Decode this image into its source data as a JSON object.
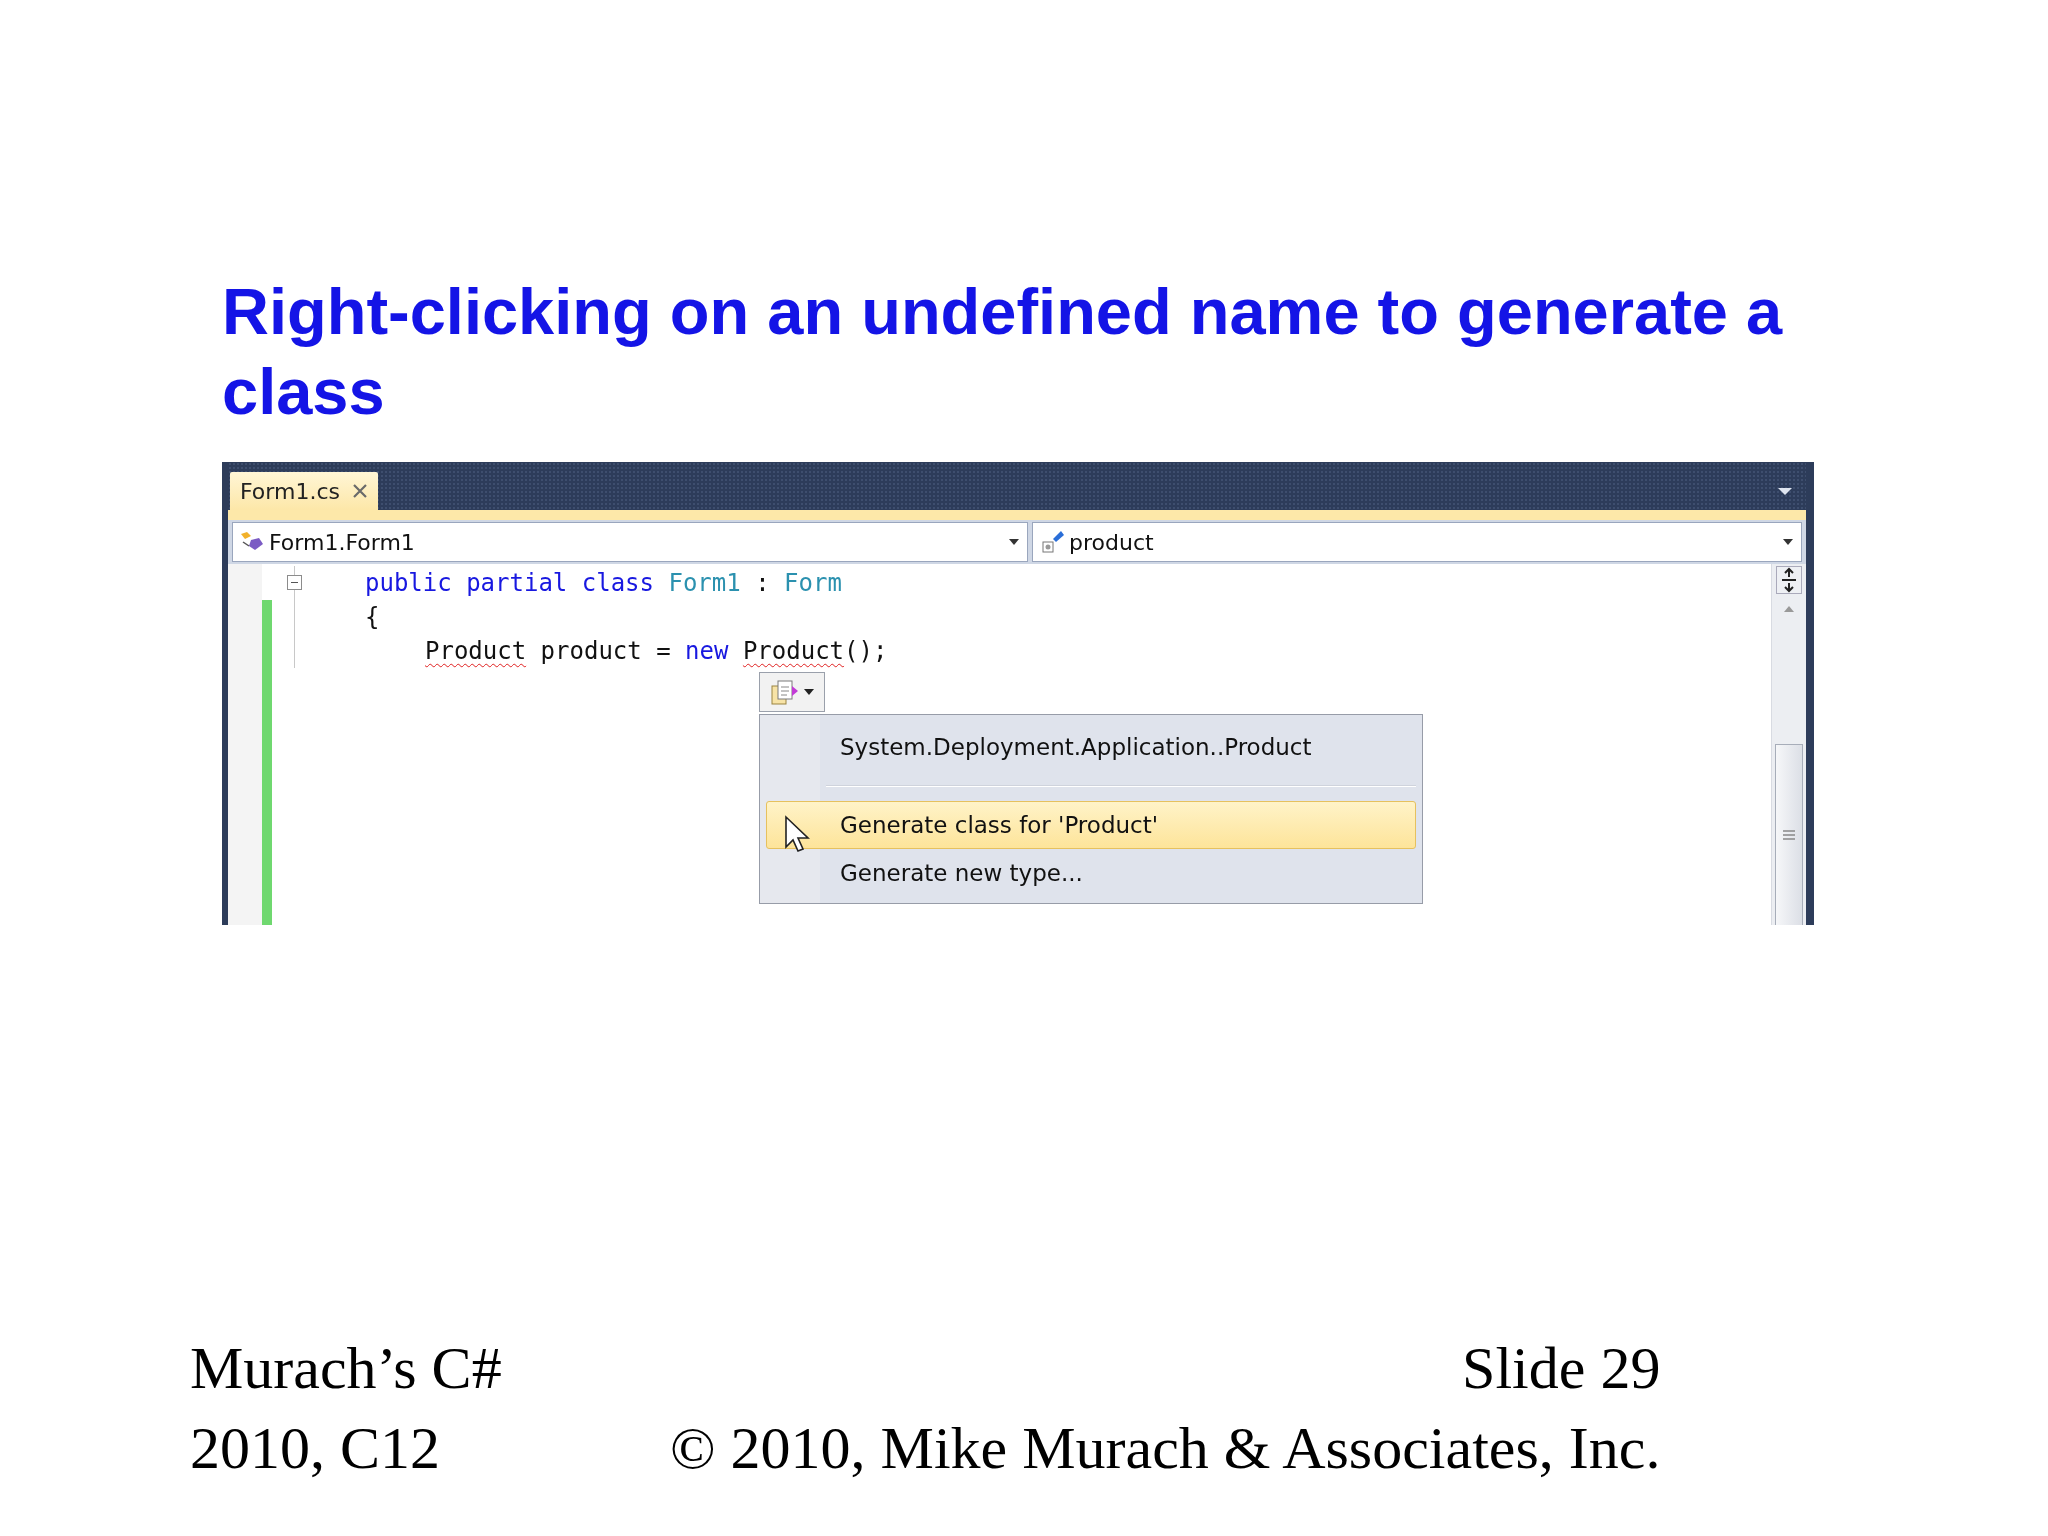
{
  "slide": {
    "title": "Right-clicking on an undefined name to generate a class"
  },
  "editor": {
    "tabs": [
      {
        "label": "Form1.cs",
        "selected": true
      }
    ],
    "type_dropdown": "Form1.Form1",
    "member_dropdown": "product",
    "code": [
      {
        "expanded": true,
        "tokens": [
          {
            "kind": "keyword",
            "text": "public partial class "
          },
          {
            "kind": "type",
            "text": "Form1"
          },
          {
            "kind": "plain",
            "text": " : "
          },
          {
            "kind": "type",
            "text": "Form"
          }
        ]
      },
      {
        "tokens": [
          {
            "kind": "plain",
            "text": "{"
          }
        ],
        "children": [
          {
            "tokens": [
              {
                "kind": "error",
                "text": "Product"
              },
              {
                "kind": "plain",
                "text": " product = "
              },
              {
                "kind": "keyword",
                "text": "new "
              },
              {
                "kind": "error",
                "text": "Product"
              },
              {
                "kind": "plain",
                "text": "();"
              }
            ]
          }
        ]
      }
    ],
    "context_menu": {
      "items": [
        {
          "kind": "item",
          "label": "System.Deployment.Application..Product",
          "selected": false
        },
        {
          "kind": "separator"
        },
        {
          "kind": "item",
          "label": "Generate class for 'Product'",
          "selected": true
        },
        {
          "kind": "item",
          "label": "Generate new type...",
          "selected": false
        }
      ]
    }
  },
  "footer": {
    "course": "Murach’s C# 2010, C12",
    "copyright": "© 2010, Mike Murach & Associates, Inc.",
    "slide_number": "Slide 29"
  }
}
